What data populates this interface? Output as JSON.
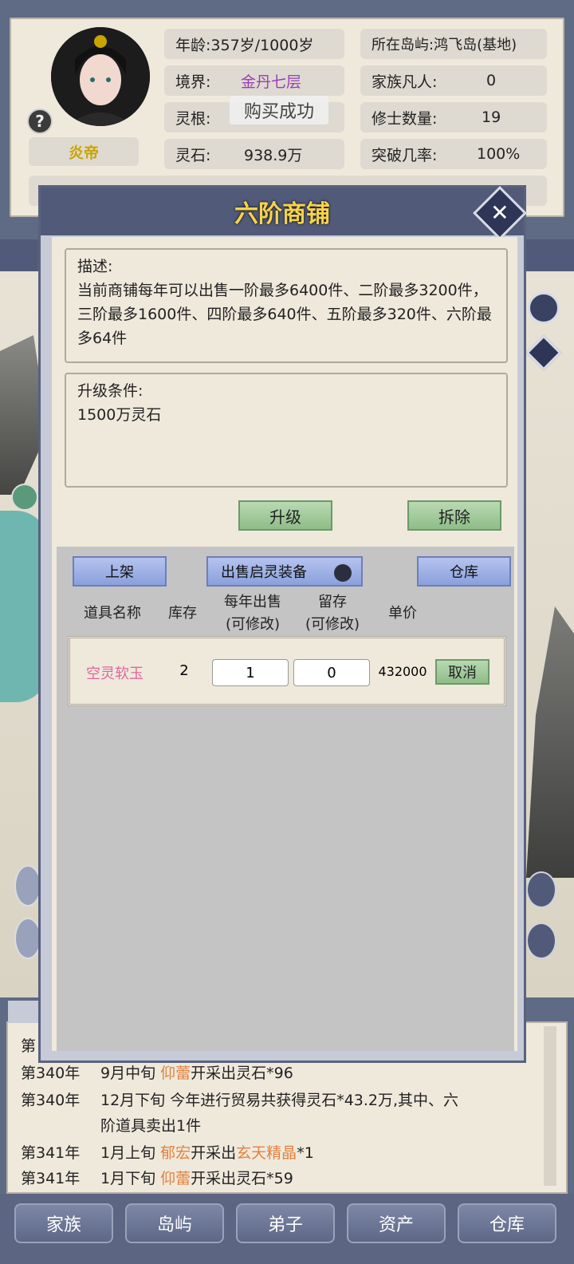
{
  "status": {
    "name": "炎帝",
    "age_label": "年龄:",
    "age_value": "357岁/1000岁",
    "realm_label": "境界:",
    "realm_value": "金丹七层",
    "root_label": "灵根:",
    "stone_label": "灵石:",
    "stone_value": "938.9万",
    "island": "所在岛屿:鸿飞岛(基地)",
    "family_label": "家族凡人:",
    "family_value": "0",
    "cultivator_label": "修士数量:",
    "cultivator_value": "19",
    "breakthrough_label": "突破几率:",
    "breakthrough_value": "100%",
    "help": "?"
  },
  "toast": "购买成功",
  "modal": {
    "title": "六阶商铺",
    "close": "✕",
    "desc_title": "描述:",
    "desc_text": "当前商铺每年可以出售一阶最多6400件、二阶最多3200件，三阶最多1600件、四阶最多640件、五阶最多320件、六阶最多64件",
    "upgrade_title": "升级条件:",
    "upgrade_text": "1500万灵石",
    "upgrade_button": "升级",
    "demolish_button": "拆除"
  },
  "shop": {
    "list_button": "上架",
    "sell_toggle_label": "出售启灵装备",
    "warehouse_button": "仓库",
    "columns": {
      "name": "道具名称",
      "stock": "库存",
      "yearly": "每年出售",
      "yearly_sub": "(可修改)",
      "keep": "留存",
      "keep_sub": "(可修改)",
      "price": "单价"
    },
    "items": [
      {
        "name": "空灵软玉",
        "stock": "2",
        "yearly": "1",
        "keep": "0",
        "price": "432000",
        "action": "取消"
      }
    ]
  },
  "log": {
    "lines": [
      {
        "year": "第",
        "text": ""
      },
      {
        "year": "第340年",
        "pre": "9月中旬 ",
        "who": "仰蕾",
        "post": "开采出灵石*96"
      },
      {
        "year": "第340年",
        "pre": "12月下旬 今年进行贸易共获得灵石*43.2万,其中、六",
        "who": "",
        "post": ""
      },
      {
        "year": "",
        "pre": "阶道具卖出1件",
        "who": "",
        "post": ""
      },
      {
        "year": "第341年",
        "pre": "1月上旬 ",
        "who": "郁宏",
        "post": "开采出",
        "item": "玄天精晶",
        "tail": "*1"
      },
      {
        "year": "第341年",
        "pre": "1月下旬 ",
        "who": "仰蕾",
        "post": "开采出灵石*59"
      }
    ]
  },
  "nav": [
    "家族",
    "岛屿",
    "弟子",
    "资产",
    "仓库"
  ],
  "colors": {
    "accent_gold": "#f6d34a",
    "realm_purple": "#9b3fb5",
    "item_pink": "#e0669e",
    "log_orange": "#e3823e"
  }
}
